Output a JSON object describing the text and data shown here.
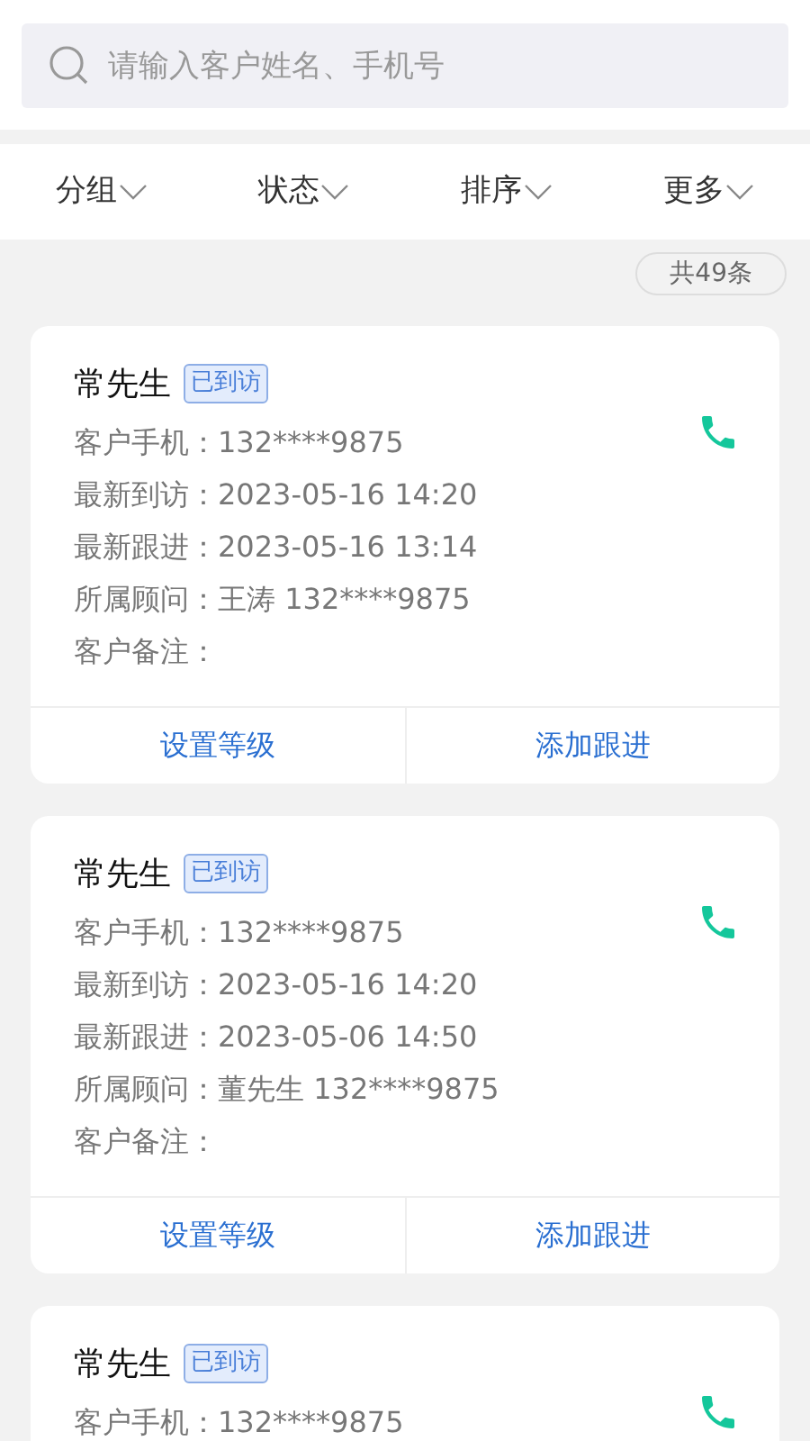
{
  "search": {
    "placeholder": "请输入客户姓名、手机号"
  },
  "filters": [
    {
      "label": "分组"
    },
    {
      "label": "状态"
    },
    {
      "label": "排序"
    },
    {
      "label": "更多"
    }
  ],
  "total": "共49条",
  "customers": [
    {
      "name": "常先生",
      "tag": "已到访",
      "fields": [
        {
          "label": "客户手机：",
          "value": "132****9875"
        },
        {
          "label": "最新到访：",
          "value": "2023-05-16 14:20"
        },
        {
          "label": "最新跟进：",
          "value": "2023-05-16 13:14"
        },
        {
          "label": "所属顾问：",
          "value": "王涛 132****9875"
        },
        {
          "label": "客户备注："
        }
      ],
      "actions": [
        "设置等级",
        "添加跟进"
      ]
    },
    {
      "name": "常先生",
      "tag": "已到访",
      "fields": [
        {
          "label": "客户手机：",
          "value": "132****9875"
        },
        {
          "label": "最新到访：",
          "value": "2023-05-16 14:20"
        },
        {
          "label": "最新跟进：",
          "value": "2023-05-06 14:50"
        },
        {
          "label": "所属顾问：",
          "value": "董先生 132****9875"
        },
        {
          "label": "客户备注："
        }
      ],
      "actions": [
        "设置等级",
        "添加跟进"
      ]
    },
    {
      "name": "常先生",
      "tag": "已到访",
      "fields": [
        {
          "label": "客户手机：",
          "value": "132****9875"
        }
      ]
    }
  ]
}
